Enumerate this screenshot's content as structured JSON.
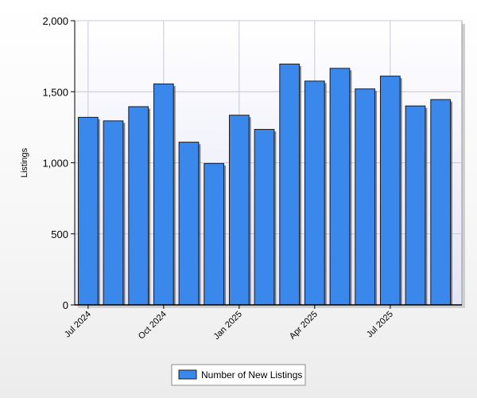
{
  "chart_data": {
    "type": "bar",
    "ylabel": "Listings",
    "ylim": [
      0,
      2000
    ],
    "yticks": [
      0,
      500,
      1000,
      1500,
      2000
    ],
    "ytick_labels": [
      "0",
      "500",
      "1,000",
      "1,500",
      "2,000"
    ],
    "categories": [
      "Jul 2024",
      "Aug 2024",
      "Sep 2024",
      "Oct 2024",
      "Nov 2024",
      "Dec 2024",
      "Jan 2025",
      "Feb 2025",
      "Mar 2025",
      "Apr 2025",
      "May 2025",
      "Jun 2025",
      "Jul 2025",
      "Aug 2025",
      "Sep 2025"
    ],
    "xtick_labels": [
      {
        "index": 0,
        "label": "Jul 2024"
      },
      {
        "index": 3,
        "label": "Oct 2024"
      },
      {
        "index": 6,
        "label": "Jan 2025"
      },
      {
        "index": 9,
        "label": "Apr 2025"
      },
      {
        "index": 12,
        "label": "Jul 2025"
      }
    ],
    "series": [
      {
        "name": "Number of New Listings",
        "color": "#3b88ec",
        "values": [
          1320,
          1295,
          1395,
          1555,
          1145,
          995,
          1335,
          1235,
          1695,
          1575,
          1665,
          1520,
          1610,
          1400,
          1445
        ]
      }
    ],
    "grid": true,
    "legend": "bottom-center"
  },
  "colors": {
    "plot_bg_top": "#ffffff",
    "plot_bg_bottom": "#e4e4f8",
    "bar_fill": "#3b88ec",
    "bar_stroke": "#1c1c1c",
    "grid": "#c8c8d8"
  }
}
